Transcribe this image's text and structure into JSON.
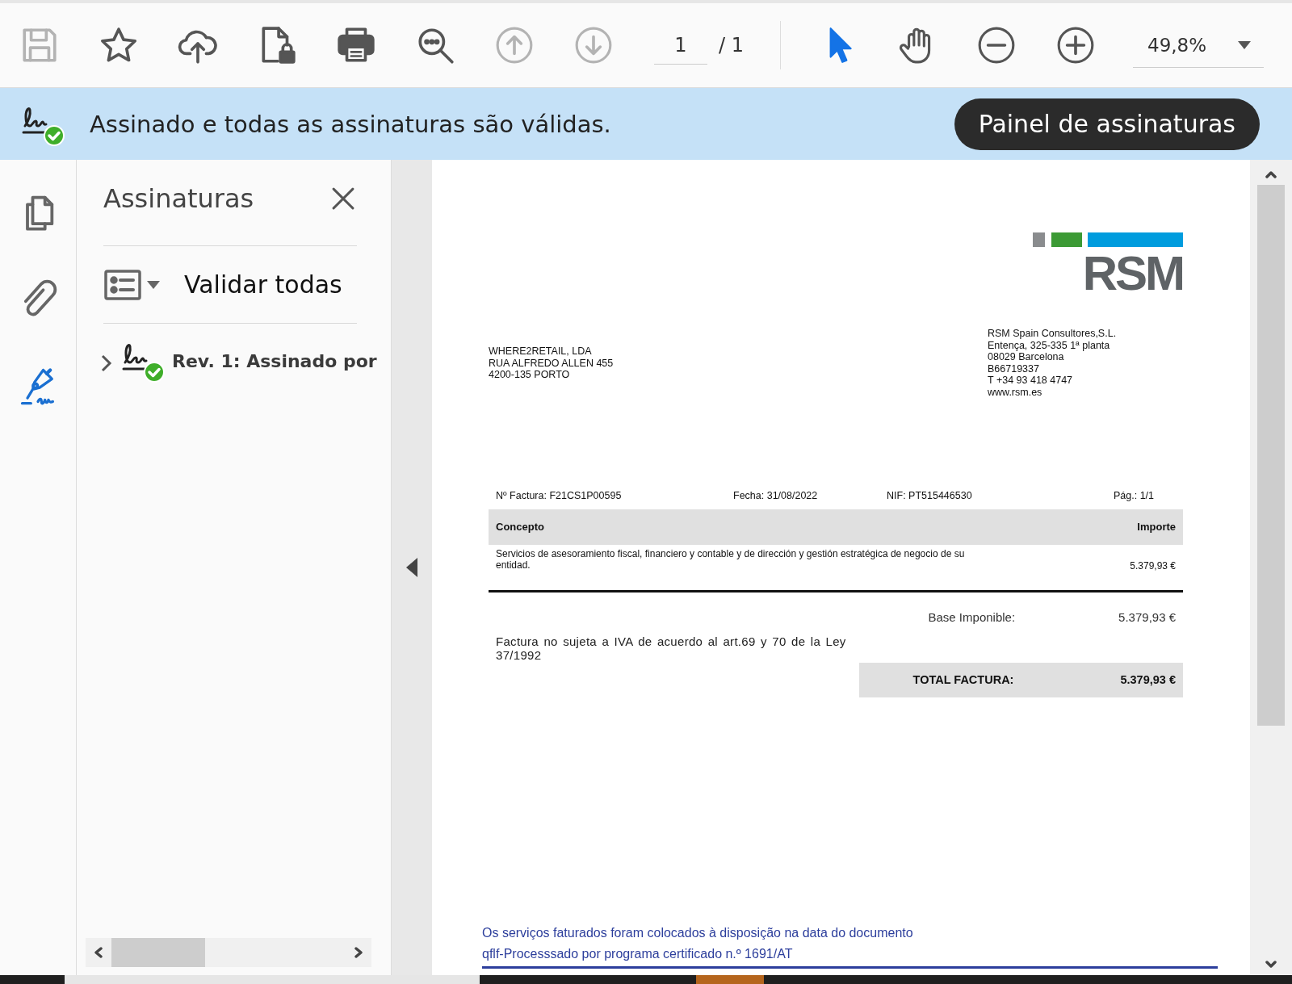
{
  "toolbar": {
    "tools": [
      {
        "kind": "save",
        "disabled": true
      },
      {
        "kind": "bookmark",
        "disabled": false
      },
      {
        "kind": "upload",
        "disabled": false
      },
      {
        "kind": "protect",
        "disabled": false
      },
      {
        "kind": "print",
        "disabled": false
      },
      {
        "kind": "find",
        "disabled": false
      },
      {
        "kind": "prev-page",
        "disabled": true
      },
      {
        "kind": "next-page",
        "disabled": true
      }
    ],
    "page_current": "1",
    "page_total": "/ 1",
    "modes": [
      {
        "kind": "select",
        "selected": true
      },
      {
        "kind": "hand",
        "selected": false
      },
      {
        "kind": "zoom-out",
        "selected": false
      },
      {
        "kind": "zoom-in",
        "selected": false
      }
    ],
    "zoom_value": "49,8%"
  },
  "signature_bar": {
    "message": "Assinado e todas as assinaturas são válidas.",
    "button": "Painel de assinaturas"
  },
  "left_rail": [
    {
      "kind": "pages",
      "selected": false
    },
    {
      "kind": "attachments",
      "selected": false
    },
    {
      "kind": "signatures",
      "selected": true
    }
  ],
  "signatures_panel": {
    "title": "Assinaturas",
    "action": "Validar todas",
    "signatures": [
      {
        "label": "Rev. 1: Assinado por",
        "expanded": false
      }
    ]
  },
  "document": {
    "logo": "RSM",
    "recipient": [
      "WHERE2RETAIL, LDA",
      "RUA ALFREDO ALLEN 455",
      "4200-135 PORTO"
    ],
    "issuer": [
      "RSM Spain Consultores,S.L.",
      "Entença, 325-335 1ª planta",
      "08029 Barcelona",
      "B66719337",
      "T +34 93 418 4747",
      "www.rsm.es"
    ],
    "meta": [
      "Nº Factura: F21CS1P00595",
      "Fecha: 31/08/2022",
      "NIF: PT515446530",
      "Pág.: 1/1"
    ],
    "table": {
      "columns": [
        "Concepto",
        "Importe"
      ],
      "rows": [
        [
          "Servicios de asesoramiento fiscal, financiero y contable y de dirección y gestión estratégica de negocio de su entidad.",
          "5.379,93 €"
        ]
      ]
    },
    "base": {
      "label": "Base Imponible:",
      "value": "5.379,93 €"
    },
    "note": "Factura no sujeta a IVA de acuerdo al art.69 y 70 de la Ley 37/1992",
    "total": {
      "label": "TOTAL FACTURA:",
      "value": "5.379,93 €"
    },
    "footer": [
      "Os serviços faturados foram colocados à disposição na data do documento",
      "qflf-Processsado por programa certificado n.º 1691/AT"
    ]
  }
}
